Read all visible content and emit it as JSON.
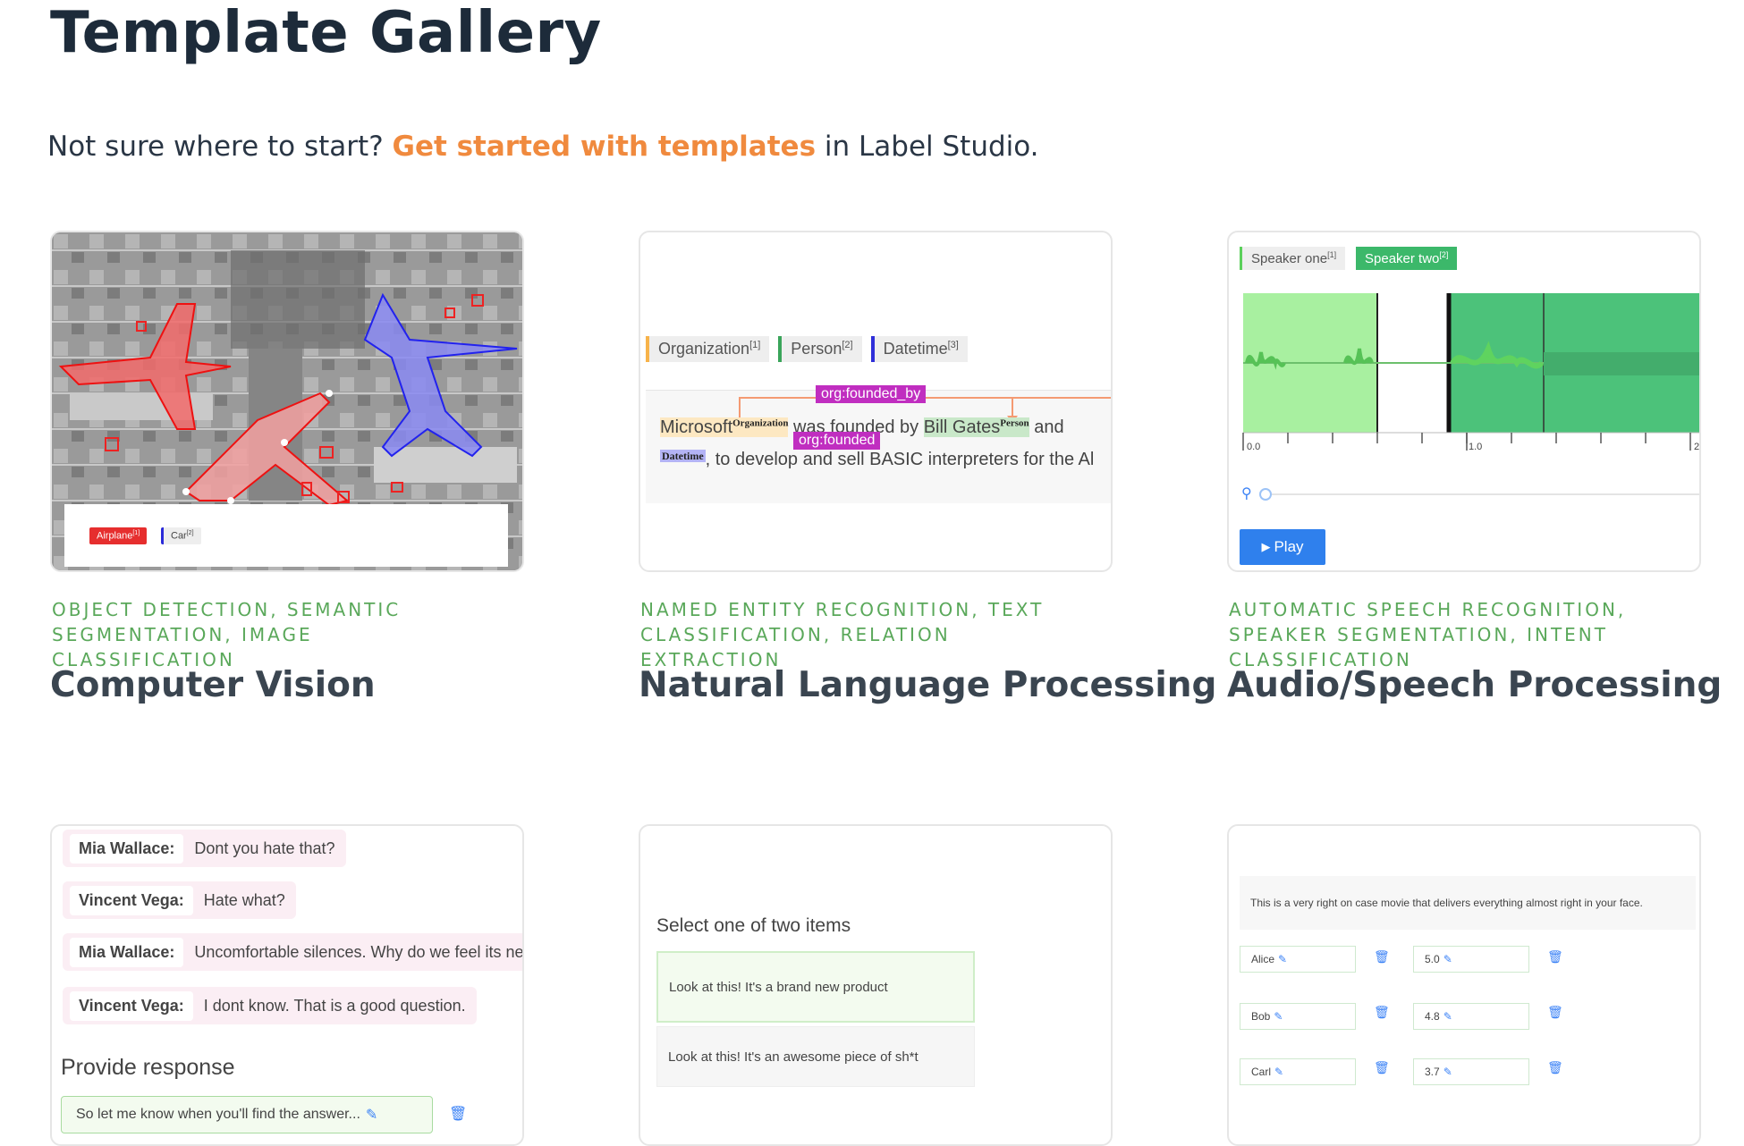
{
  "header": {
    "title": "Template Gallery",
    "intro_prefix": "Not sure where to start? ",
    "intro_link": "Get started with templates",
    "intro_suffix": " in Label Studio."
  },
  "cards": [
    {
      "tags": "OBJECT DETECTION, SEMANTIC SEGMENTATION, IMAGE CLASSIFICATION",
      "title": "Computer Vision",
      "preview": {
        "labels": [
          "Airplane",
          "Car"
        ],
        "label_superscripts": [
          "[1]",
          "[2]"
        ]
      }
    },
    {
      "tags": "NAMED ENTITY RECOGNITION, TEXT CLASSIFICATION, RELATION EXTRACTION",
      "title": "Natural Language Processing",
      "preview": {
        "labels": [
          "Organization",
          "Person",
          "Datetime"
        ],
        "label_superscripts": [
          "[1]",
          "[2]",
          "[3]"
        ],
        "relation_top": "org:founded_by",
        "relation_bottom": "org:founded",
        "text_line1_a": "Microsoft",
        "text_line1_tag_a": "Organization",
        "text_line1_b": " was founded by ",
        "text_line1_c": "Bill Gates",
        "text_line1_tag_c": "Person",
        "text_line1_d": " and",
        "text_line2_tag": "Datetime",
        "text_line2": ", to develop and sell BASIC interpreters for the Al"
      }
    },
    {
      "tags": "AUTOMATIC SPEECH RECOGNITION, SPEAKER SEGMENTATION, INTENT CLASSIFICATION",
      "title": "Audio/Speech Processing",
      "preview": {
        "labels": [
          "Speaker one",
          "Speaker two"
        ],
        "label_superscripts": [
          "[1]",
          "[2]"
        ],
        "ticks": [
          "0.0",
          "1.0",
          "2"
        ],
        "play": "Play"
      }
    }
  ],
  "row2": {
    "chat": {
      "messages": [
        {
          "who": "Mia Wallace:",
          "text": "Dont you hate that?"
        },
        {
          "who": "Vincent Vega:",
          "text": "Hate what?"
        },
        {
          "who": "Mia Wallace:",
          "text": "Uncomfortable silences. Why do we feel its nec"
        },
        {
          "who": "Vincent Vega:",
          "text": "I dont know. That is a good question."
        }
      ],
      "response_heading": "Provide response",
      "response_value": "So let me know when you'll find the answer..."
    },
    "pairwise": {
      "heading": "Select one of two items",
      "item_a": "Look at this! It's a brand new product",
      "item_b": "Look at this! It's an awesome piece of sh*t"
    },
    "rating": {
      "text": "This is a very right on case movie that delivers everything almost right in your face.",
      "rows": [
        {
          "name": "Alice",
          "score": "5.0"
        },
        {
          "name": "Bob",
          "score": "4.8"
        },
        {
          "name": "Carl",
          "score": "3.7"
        }
      ]
    }
  },
  "colors": {
    "accent_orange": "#f08a3e",
    "tag_green": "#5aa85a",
    "title_dark": "#1d2b3a",
    "audio_light_green": "#a8f0a0",
    "audio_dark_green": "#4cc27a",
    "play_blue": "#2f80ed"
  }
}
